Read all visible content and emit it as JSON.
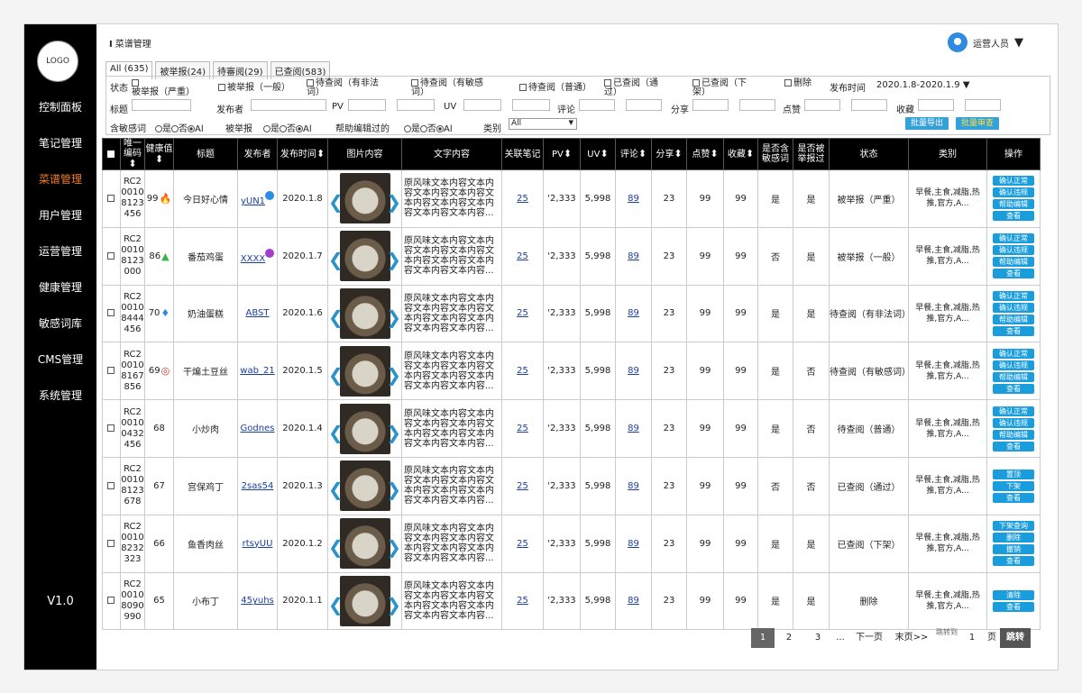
{
  "sidebar": {
    "logo": "LOGO",
    "items": [
      {
        "label": "控制面板",
        "active": false
      },
      {
        "label": "笔记管理",
        "active": false
      },
      {
        "label": "菜谱管理",
        "active": true
      },
      {
        "label": "用户管理",
        "active": false
      },
      {
        "label": "运营管理",
        "active": false
      },
      {
        "label": "健康管理",
        "active": false
      },
      {
        "label": "敏感词库",
        "active": false
      },
      {
        "label": "CMS管理",
        "active": false
      },
      {
        "label": "系统管理",
        "active": false
      }
    ],
    "version": "V1.0"
  },
  "header": {
    "breadcrumb": "菜谱管理",
    "user": "运营人员"
  },
  "tabs": [
    "All (635)",
    "被举报(24)",
    "待審阅(29)",
    "已查阅(583)"
  ],
  "filters": {
    "status_label": "状态",
    "status_options": [
      "被举报（严重）",
      "被举报（一般）",
      "待查阅（有非法词）",
      "待查阅（有敏感词）",
      "待查阅（普通）",
      "已查阅（通过）",
      "已查阅（下架）",
      "删除"
    ],
    "publish_time_label": "发布时间",
    "publish_time": "2020.1.8-2020.1.9",
    "title_label": "标题",
    "publisher_label": "发布者",
    "pv_label": "PV",
    "uv_label": "UV",
    "comment_label": "评论",
    "share_label": "分享",
    "like_label": "点赞",
    "fav_label": "收藏",
    "sensitive_label": "含敏感词",
    "reported_label": "被举报",
    "helped_label": "帮助编辑过的",
    "category_label": "类别",
    "yes": "是",
    "no": "否",
    "all": "Al",
    "category_value": "All",
    "export_btn": "批量导出",
    "review_btn": "批量审查"
  },
  "table": {
    "headers": [
      "唯一编码",
      "健康值",
      "标题",
      "发布者",
      "发布时间",
      "图片内容",
      "文字内容",
      "关联笔记",
      "PV",
      "UV",
      "评论",
      "分享",
      "点赞",
      "收藏",
      "是否含敏感词",
      "是否被举报过",
      "状态",
      "类别",
      "操作"
    ],
    "rows": [
      {
        "id": "RC2 0010 8123 456",
        "health": "99",
        "icon": "fire",
        "title": "今日好心情",
        "publisher": "yUN1",
        "badge": "blue",
        "date": "2020.1.8",
        "text": "原风味文本内容文本内容文本内容文本内容文本内容文本内容文本内容文本内容文本内容...",
        "notes": "25",
        "pv": "'2,333",
        "uv": "5,998",
        "comments": "89",
        "shares": "23",
        "likes": "99",
        "favs": "99",
        "sensitive": "是",
        "reported": "是",
        "status": "被举报（严重）",
        "category": "早餐,主食,减脂,热推,官方,A...",
        "ops": [
          "确认正常",
          "确认违规",
          "帮助编辑",
          "查看"
        ]
      },
      {
        "id": "RC2 0010 8123 000",
        "health": "86",
        "icon": "leaf",
        "title": "番茄鸡蛋",
        "publisher": "XXXX",
        "badge": "purple",
        "date": "2020.1.7",
        "text": "原风味文本内容文本内容文本内容文本内容文本内容文本内容文本内容文本内容文本内容...",
        "notes": "25",
        "pv": "'2,333",
        "uv": "5,998",
        "comments": "89",
        "shares": "23",
        "likes": "99",
        "favs": "99",
        "sensitive": "否",
        "reported": "是",
        "status": "被举报（一般）",
        "category": "早餐,主食,减脂,热推,官方,A...",
        "ops": [
          "确认正常",
          "确认违规",
          "帮助编辑",
          "查看"
        ]
      },
      {
        "id": "RC2 0010 8444 456",
        "health": "70",
        "icon": "drop",
        "title": "奶油蛋糕",
        "publisher": "ABST",
        "badge": "",
        "date": "2020.1.6",
        "text": "原风味文本内容文本内容文本内容文本内容文本内容文本内容文本内容文本内容文本内容...",
        "notes": "25",
        "pv": "'2,333",
        "uv": "5,998",
        "comments": "89",
        "shares": "23",
        "likes": "99",
        "favs": "99",
        "sensitive": "是",
        "reported": "是",
        "status": "待查阅（有非法词）",
        "category": "早餐,主食,减脂,热推,官方,A...",
        "ops": [
          "确认正常",
          "确认违规",
          "帮助编辑",
          "查看"
        ]
      },
      {
        "id": "RC2 0010 8167 856",
        "health": "69",
        "icon": "shield",
        "title": "干煸土豆丝",
        "publisher": "wab_21",
        "badge": "",
        "date": "2020.1.5",
        "text": "原风味文本内容文本内容文本内容文本内容文本内容文本内容文本内容文本内容文本内容...",
        "notes": "25",
        "pv": "'2,333",
        "uv": "5,998",
        "comments": "89",
        "shares": "23",
        "likes": "99",
        "favs": "99",
        "sensitive": "是",
        "reported": "否",
        "status": "待查阅（有敏感词）",
        "category": "早餐,主食,减脂,热推,官方,A...",
        "ops": [
          "确认正常",
          "确认违规",
          "帮助编辑",
          "查看"
        ]
      },
      {
        "id": "RC2 0010 0432 456",
        "health": "68",
        "icon": "",
        "title": "小炒肉",
        "publisher": "Godnes",
        "badge": "",
        "date": "2020.1.4",
        "text": "原风味文本内容文本内容文本内容文本内容文本内容文本内容文本内容文本内容文本内容...",
        "notes": "25",
        "pv": "'2,333",
        "uv": "5,998",
        "comments": "89",
        "shares": "23",
        "likes": "99",
        "favs": "99",
        "sensitive": "是",
        "reported": "否",
        "status": "待查阅（普通）",
        "category": "早餐,主食,减脂,热推,官方,A...",
        "ops": [
          "确认正常",
          "确认违规",
          "帮助编辑",
          "查看"
        ]
      },
      {
        "id": "RC2 0010 8123 678",
        "health": "67",
        "icon": "",
        "title": "宫保鸡丁",
        "publisher": "2sas54",
        "badge": "",
        "date": "2020.1.3",
        "text": "原风味文本内容文本内容文本内容文本内容文本内容文本内容文本内容文本内容文本内容...",
        "notes": "25",
        "pv": "'2,333",
        "uv": "5,998",
        "comments": "89",
        "shares": "23",
        "likes": "99",
        "favs": "99",
        "sensitive": "否",
        "reported": "否",
        "status": "已查阅（通过）",
        "category": "早餐,主食,减脂,热推,官方,A...",
        "ops": [
          "置顶",
          "下架",
          "查看"
        ]
      },
      {
        "id": "RC2 0010 8232 323",
        "health": "66",
        "icon": "",
        "title": "鱼香肉丝",
        "publisher": "rtsyUU",
        "badge": "",
        "date": "2020.1.2",
        "text": "原风味文本内容文本内容文本内容文本内容文本内容文本内容文本内容文本内容文本内容...",
        "notes": "25",
        "pv": "'2,333",
        "uv": "5,998",
        "comments": "89",
        "shares": "23",
        "likes": "99",
        "favs": "99",
        "sensitive": "是",
        "reported": "是",
        "status": "已查阅（下架）",
        "category": "早餐,主食,减脂,热推,官方,A...",
        "ops": [
          "下架查询",
          "删除",
          "撤销",
          "查看"
        ]
      },
      {
        "id": "RC2 0010 8090 990",
        "health": "65",
        "icon": "",
        "title": "小布丁",
        "publisher": "45yuhs",
        "badge": "",
        "date": "2020.1.1",
        "text": "原风味文本内容文本内容文本内容文本内容文本内容文本内容文本内容文本内容文本内容...",
        "notes": "25",
        "pv": "'2,333",
        "uv": "5,998",
        "comments": "89",
        "shares": "23",
        "likes": "99",
        "favs": "99",
        "sensitive": "是",
        "reported": "是",
        "status": "删除",
        "category": "早餐,主食,减脂,热推,官方,A...",
        "ops": [
          "清除",
          "查看"
        ]
      }
    ]
  },
  "pager": {
    "pages": [
      "1",
      "2",
      "3"
    ],
    "current": "1",
    "ellipsis": "...",
    "next": "下一页",
    "last": "末页>>",
    "jump_label": "跳转到",
    "jump_value": "1",
    "page_unit": "页",
    "go": "跳转"
  },
  "colors": {
    "accent": "#1a9ddc",
    "active_nav": "#f07c2c",
    "fire": "#e0301e",
    "leaf": "#3ab54a",
    "drop": "#2e8be0",
    "shield": "#c0392b",
    "badge_blue": "#2e8be0",
    "badge_purple": "#a23ec8"
  }
}
